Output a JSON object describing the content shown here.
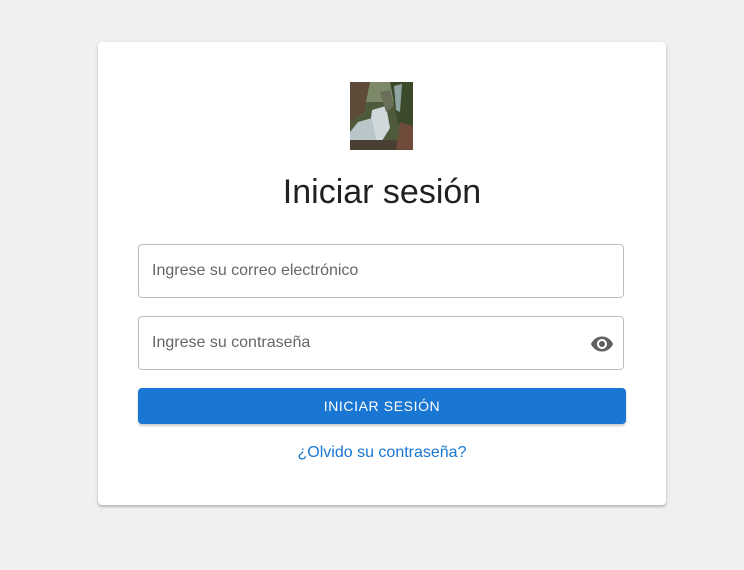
{
  "login": {
    "logo_alt": "waterfall photo",
    "title": "Iniciar sesión",
    "email": {
      "placeholder": "Ingrese su correo electrónico",
      "value": ""
    },
    "password": {
      "placeholder": "Ingrese su contraseña",
      "value": "",
      "toggle_icon": "eye-icon"
    },
    "submit_label": "INICIAR SESIÓN",
    "forgot_link": "¿Olvido su contraseña?"
  },
  "colors": {
    "background": "#f0f0f0",
    "card": "#ffffff",
    "primary": "#1976d2",
    "title_text": "#212121",
    "placeholder": "#666666",
    "border": "#bdbdbd"
  }
}
